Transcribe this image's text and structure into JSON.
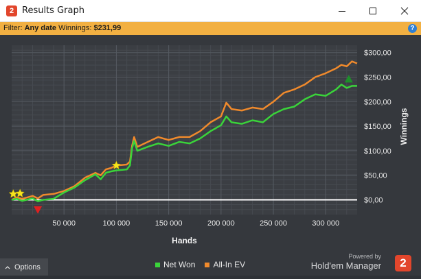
{
  "window": {
    "title": "Results Graph",
    "app_icon_glyph": "2",
    "controls": [
      "minimize-icon",
      "maximize-icon",
      "close-icon"
    ]
  },
  "filter": {
    "label": "Filter:",
    "date_value": "Any date",
    "winnings_label": "Winnings:",
    "winnings_value": "$231,99",
    "help_glyph": "?"
  },
  "footer": {
    "options_label": "Options",
    "options_icon": "chevron-up-icon",
    "powered_by": "Powered by",
    "brand_name": "Hold'em Manager",
    "brand_logo_glyph": "2"
  },
  "colors": {
    "net_won": "#3ad43a",
    "all_in_ev": "#f08a2c",
    "filter_bar": "#f2b042",
    "background": "#35383d"
  },
  "chart_data": {
    "type": "line",
    "xlabel": "Hands",
    "ylabel": "Winnings",
    "xlim": [
      0,
      330000
    ],
    "ylim": [
      -30,
      315
    ],
    "x_ticks": [
      50000,
      100000,
      150000,
      200000,
      250000,
      300000
    ],
    "x_tick_labels": [
      "50 000",
      "100 000",
      "150 000",
      "200 000",
      "250 000",
      "300 000"
    ],
    "y_ticks": [
      0,
      50,
      100,
      150,
      200,
      250,
      300
    ],
    "y_tick_labels": [
      "$0,00",
      "$50,00",
      "$100,00",
      "$150,00",
      "$200,00",
      "$250,00",
      "$300,00"
    ],
    "grid": true,
    "legend_position": "bottom-center",
    "x": [
      0,
      5000,
      10000,
      20000,
      25000,
      30000,
      40000,
      50000,
      60000,
      70000,
      80000,
      85000,
      90000,
      95000,
      100000,
      110000,
      113000,
      115000,
      117000,
      120000,
      130000,
      140000,
      150000,
      160000,
      170000,
      180000,
      190000,
      200000,
      205000,
      210000,
      220000,
      230000,
      240000,
      250000,
      260000,
      270000,
      280000,
      290000,
      300000,
      310000,
      315000,
      320000,
      325000,
      330000
    ],
    "series": [
      {
        "name": "Net Won",
        "values": [
          0,
          2,
          -2,
          3,
          -3,
          0,
          2,
          15,
          25,
          40,
          52,
          42,
          55,
          58,
          60,
          62,
          70,
          105,
          120,
          100,
          108,
          115,
          110,
          118,
          115,
          125,
          140,
          152,
          170,
          158,
          155,
          162,
          158,
          175,
          185,
          190,
          205,
          215,
          212,
          225,
          235,
          228,
          232,
          232
        ]
      },
      {
        "name": "All-In EV",
        "values": [
          0,
          5,
          2,
          8,
          3,
          10,
          12,
          18,
          28,
          45,
          55,
          50,
          62,
          65,
          70,
          72,
          78,
          110,
          128,
          108,
          118,
          128,
          122,
          128,
          128,
          140,
          158,
          170,
          198,
          185,
          182,
          188,
          185,
          200,
          218,
          225,
          235,
          250,
          258,
          268,
          275,
          272,
          282,
          278
        ]
      }
    ],
    "markers": [
      {
        "type": "star",
        "color": "#f6e51e",
        "x": 1500,
        "y": 12
      },
      {
        "type": "star",
        "color": "#f6e51e",
        "x": 8000,
        "y": 13
      },
      {
        "type": "star",
        "color": "#f6e51e",
        "x": 100000,
        "y": 70
      },
      {
        "type": "triangle-down",
        "color": "#e02020",
        "x": 25000,
        "y": -20
      },
      {
        "type": "triangle-up",
        "color": "#1d8f2a",
        "x": 322000,
        "y": 246
      }
    ]
  }
}
